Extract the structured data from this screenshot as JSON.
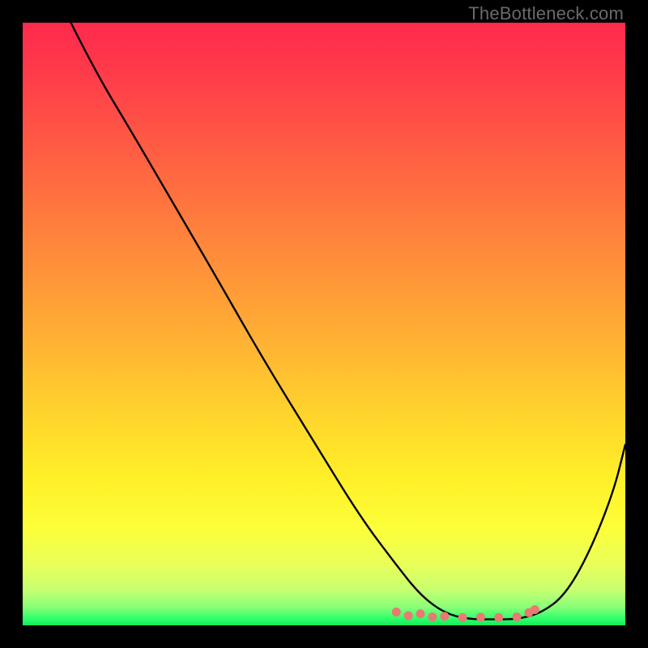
{
  "watermark": "TheBottleneck.com",
  "chart_data": {
    "type": "line",
    "title": "",
    "xlabel": "",
    "ylabel": "",
    "xlim": [
      0,
      100
    ],
    "ylim": [
      0,
      100
    ],
    "series": [
      {
        "name": "curve",
        "x": [
          8,
          12,
          18,
          25,
          32,
          40,
          48,
          56,
          62,
          66,
          70,
          74,
          78,
          82,
          86,
          90,
          94,
          98,
          100
        ],
        "values": [
          100,
          92,
          82,
          70,
          58,
          44,
          31,
          18,
          10,
          5,
          2,
          1,
          1,
          1,
          2,
          5,
          12,
          22,
          30
        ]
      }
    ],
    "markers": [
      {
        "x": 62,
        "y": 2.2
      },
      {
        "x": 64,
        "y": 1.6
      },
      {
        "x": 66,
        "y": 1.9
      },
      {
        "x": 68,
        "y": 1.4
      },
      {
        "x": 70,
        "y": 1.5
      },
      {
        "x": 73,
        "y": 1.3
      },
      {
        "x": 76,
        "y": 1.35
      },
      {
        "x": 79,
        "y": 1.3
      },
      {
        "x": 82,
        "y": 1.4
      },
      {
        "x": 84,
        "y": 2.1
      },
      {
        "x": 85,
        "y": 2.6
      }
    ],
    "gradient_stops": [
      {
        "pos": 0,
        "color": "#ff2a4d"
      },
      {
        "pos": 50,
        "color": "#ffba32"
      },
      {
        "pos": 80,
        "color": "#fcff3a"
      },
      {
        "pos": 100,
        "color": "#18e85a"
      }
    ]
  }
}
